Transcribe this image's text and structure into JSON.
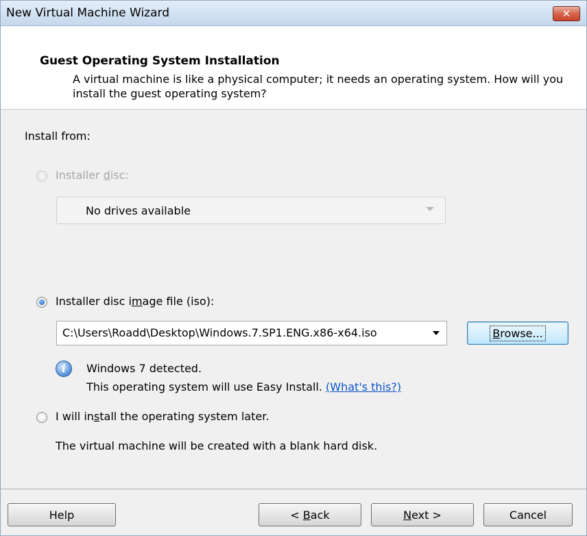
{
  "window": {
    "title": "New Virtual Machine Wizard"
  },
  "header": {
    "title": "Guest Operating System Installation",
    "description": "A virtual machine is like a physical computer; it needs an operating system. How will you install the guest operating system?"
  },
  "install": {
    "label": "Install from:",
    "disc": {
      "label_before": "Installer ",
      "label_key": "d",
      "label_after": "isc:",
      "dropdown_value": "No drives available",
      "enabled": false
    },
    "iso": {
      "label_before": "Installer disc i",
      "label_key": "m",
      "label_after": "age file (iso):",
      "path": "C:\\Users\\Roadd\\Desktop\\Windows.7.SP1.ENG.x86-x64.iso",
      "selected": true
    },
    "browse": {
      "key": "B",
      "rest": "rowse..."
    },
    "detection": {
      "line1": "Windows 7 detected.",
      "line2": "This operating system will use Easy Install. ",
      "link": "(What's this?)"
    },
    "later": {
      "label_before": "I will in",
      "label_key": "s",
      "label_after": "tall the operating system later.",
      "note": "The virtual machine will be created with a blank hard disk."
    }
  },
  "buttons": {
    "help": "Help",
    "back": {
      "prefix": "< ",
      "key": "B",
      "rest": "ack"
    },
    "next": {
      "key": "N",
      "rest": "ext >"
    },
    "cancel": "Cancel"
  },
  "colors": {
    "accent": "#3c7fb1",
    "link": "#0a52c8",
    "close": "#c6442a"
  }
}
